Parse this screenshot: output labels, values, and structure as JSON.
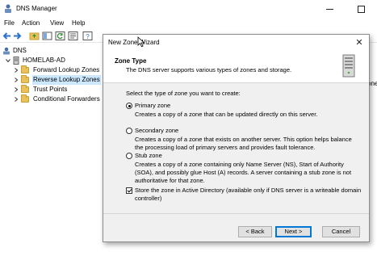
{
  "window": {
    "title": "DNS Manager"
  },
  "menu": [
    "File",
    "Action",
    "View",
    "Help"
  ],
  "tree": {
    "root": "DNS",
    "server": "HOMELAB-AD",
    "items": [
      {
        "label": "Forward Lookup Zones"
      },
      {
        "label": "Reverse Lookup Zones"
      },
      {
        "label": "Trust Points"
      },
      {
        "label": "Conditional Forwarders"
      }
    ]
  },
  "background_text": "one",
  "wizard": {
    "title": "New Zone Wizard",
    "heading": "Zone Type",
    "subheading": "The DNS server supports various types of zones and storage.",
    "prompt": "Select the type of zone you want to create:",
    "options": [
      {
        "label": "Primary zone",
        "desc": [
          "Creates a copy of a zone that can be updated directly on this server."
        ],
        "checked": true
      },
      {
        "label": "Secondary zone",
        "desc": [
          "Creates a copy of a zone that exists on another server. This option helps balance",
          "the processing load of primary servers and provides fault tolerance."
        ],
        "checked": false
      },
      {
        "label": "Stub zone",
        "desc": [
          "Creates a copy of a zone containing only Name Server (NS), Start of Authority",
          "(SOA), and possibly glue Host (A) records. A server containing a stub zone is not",
          "authoritative for that zone."
        ],
        "checked": false
      }
    ],
    "ad_store": {
      "lines": [
        "Store the zone in Active Directory (available only if DNS server is a writeable domain",
        "controller)"
      ],
      "checked": true
    },
    "buttons": {
      "back": "< Back",
      "next": "Next >",
      "cancel": "Cancel"
    }
  },
  "colors": {
    "selection": "#cce8ff",
    "accent": "#0078d7",
    "folder": "#e8c15a"
  }
}
